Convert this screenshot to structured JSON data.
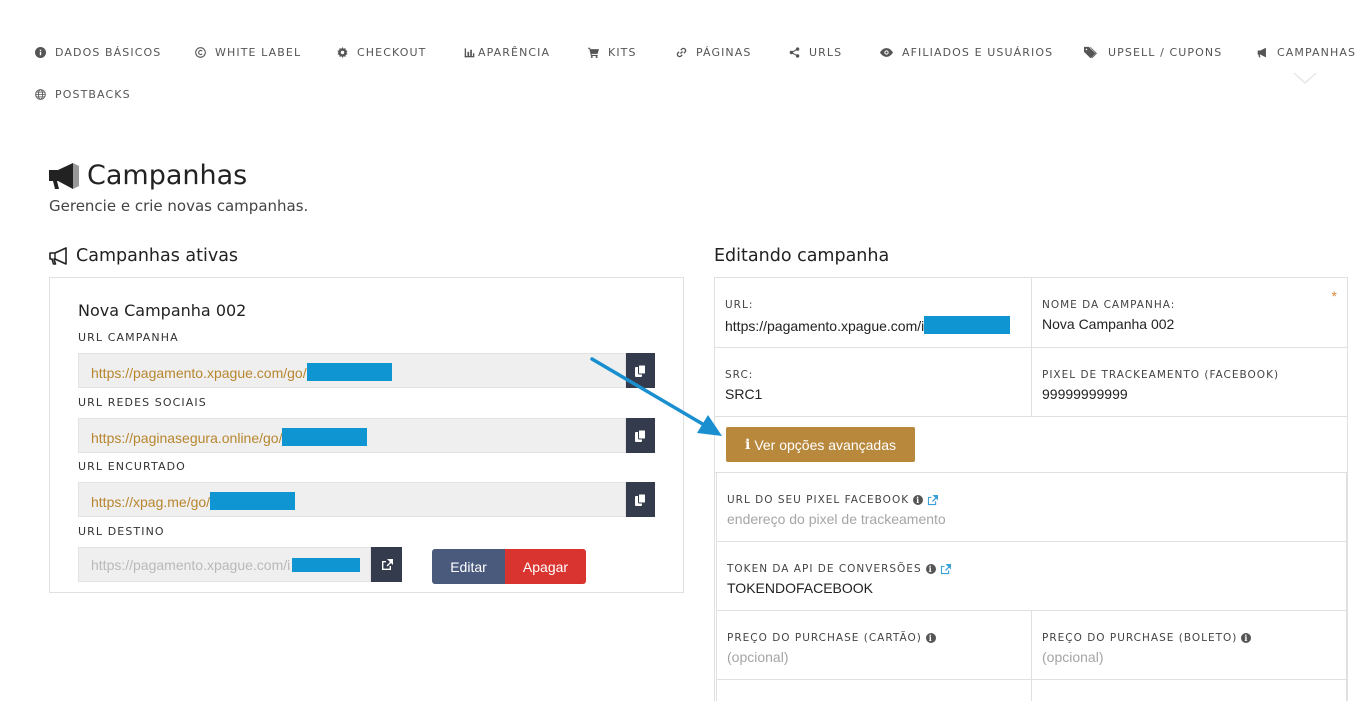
{
  "nav": {
    "items": [
      {
        "label": "DADOS BÁSICOS",
        "icon": "info-circle-icon"
      },
      {
        "label": "WHITE LABEL",
        "icon": "copyright-icon"
      },
      {
        "label": "CHECKOUT",
        "icon": "gear-icon"
      },
      {
        "label": "APARÊNCIA",
        "icon": "bar-chart-icon"
      },
      {
        "label": "KITS",
        "icon": "cart-icon"
      },
      {
        "label": "PÁGINAS",
        "icon": "link-icon"
      },
      {
        "label": "URLS",
        "icon": "share-icon"
      },
      {
        "label": "AFILIADOS E USUÁRIOS",
        "icon": "eye-icon"
      },
      {
        "label": "UPSELL / CUPONS",
        "icon": "tags-icon"
      },
      {
        "label": "CAMPANHAS",
        "icon": "megaphone-icon"
      },
      {
        "label": "POSTBACKS",
        "icon": "globe-icon"
      }
    ],
    "active": "CAMPANHAS"
  },
  "header": {
    "title": "Campanhas",
    "subtitle": "Gerencie e crie novas campanhas."
  },
  "active_campaigns": {
    "title": "Campanhas ativas",
    "campaign": {
      "name": "Nova Campanha 002",
      "url_campanha_label": "URL CAMPANHA",
      "url_campanha": "https://pagamento.xpague.com/go/",
      "url_redes_label": "URL REDES SOCIAIS",
      "url_redes": "https://paginasegura.online/go/",
      "url_encurtado_label": "URL ENCURTADO",
      "url_encurtado": "https://xpag.me/go/",
      "url_destino_label": "URL DESTINO",
      "url_destino": "https://pagamento.xpague.com/i",
      "edit_label": "Editar",
      "delete_label": "Apagar"
    }
  },
  "edit_form": {
    "title": "Editando campanha",
    "url_label": "URL:",
    "url_value": "https://pagamento.xpague.com/i",
    "nome_label": "NOME DA CAMPANHA:",
    "nome_value": "Nova Campanha 002",
    "required_mark": "*",
    "src_label": "SRC:",
    "src_value": "SRC1",
    "pixel_label": "PIXEL DE TRACKEAMENTO (FACEBOOK)",
    "pixel_value": "99999999999",
    "advanced_button": "Ver opções avançadas",
    "pixel_url_label": "URL DO SEU PIXEL FACEBOOK",
    "pixel_url_placeholder": "endereço do pixel de trackeamento",
    "token_label": "TOKEN DA API DE CONVERSÕES",
    "token_value": "TOKENDOFACEBOOK",
    "preco_cartao_label": "PREÇO DO PURCHASE (CARTÃO)",
    "preco_cartao_placeholder": "(opcional)",
    "preco_boleto_label": "PREÇO DO PURCHASE (BOLETO)",
    "preco_boleto_placeholder": "(opcional)"
  },
  "colors": {
    "accent_gold": "#b8883c",
    "url_text": "#b8862f",
    "mask_blue": "#0e95d2",
    "edit_btn": "#4a5a7d",
    "delete_btn": "#d9342f",
    "dark_btn": "#343b4d"
  }
}
